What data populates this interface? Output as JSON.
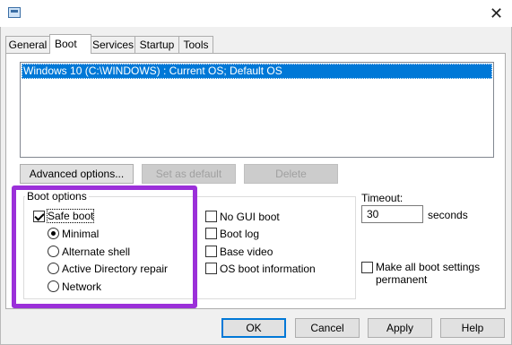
{
  "window": {
    "icon": "msconfig-icon",
    "close_glyph": "✕"
  },
  "tabs": [
    {
      "label": "General",
      "active": false
    },
    {
      "label": "Boot",
      "active": true
    },
    {
      "label": "Services",
      "active": false
    },
    {
      "label": "Startup",
      "active": false
    },
    {
      "label": "Tools",
      "active": false
    }
  ],
  "os_list": {
    "items": [
      "Windows 10 (C:\\WINDOWS) : Current OS; Default OS"
    ],
    "selected_index": 0
  },
  "os_buttons": {
    "advanced": {
      "label": "Advanced options...",
      "enabled": true
    },
    "set_default": {
      "label": "Set as default",
      "enabled": false
    },
    "delete": {
      "label": "Delete",
      "enabled": false
    }
  },
  "boot_options": {
    "group_label": "Boot options",
    "safe_boot": {
      "label": "Safe boot",
      "checked": true
    },
    "radios": [
      {
        "label": "Minimal",
        "selected": true
      },
      {
        "label": "Alternate shell",
        "selected": false
      },
      {
        "label": "Active Directory repair",
        "selected": false
      },
      {
        "label": "Network",
        "selected": false
      }
    ],
    "checks": [
      {
        "label": "No GUI boot",
        "checked": false
      },
      {
        "label": "Boot log",
        "checked": false
      },
      {
        "label": "Base video",
        "checked": false
      },
      {
        "label": "OS boot information",
        "checked": false
      }
    ]
  },
  "timeout": {
    "label": "Timeout:",
    "value": "30",
    "unit": "seconds"
  },
  "permanent": {
    "label_line1": "Make all boot settings",
    "label_line2": "permanent",
    "checked": false
  },
  "footer": {
    "ok": "OK",
    "cancel": "Cancel",
    "apply": "Apply",
    "help": "Help"
  },
  "colors": {
    "highlight": "#9b30d9",
    "selection": "#0078d7"
  }
}
